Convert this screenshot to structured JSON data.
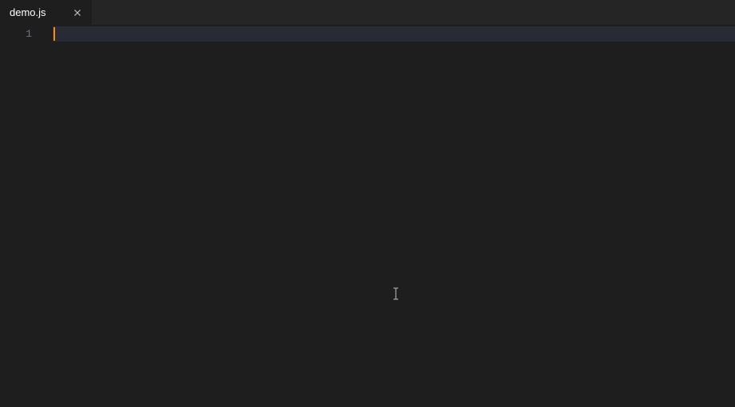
{
  "tabs": [
    {
      "label": "demo.js",
      "active": true
    }
  ],
  "editor": {
    "line_numbers": [
      "1"
    ],
    "content_lines": [
      ""
    ],
    "current_line_index": 0
  },
  "colors": {
    "background": "#1e1e1e",
    "tab_bar": "#252526",
    "current_line": "#282a36",
    "caret": "#ff8c00"
  }
}
